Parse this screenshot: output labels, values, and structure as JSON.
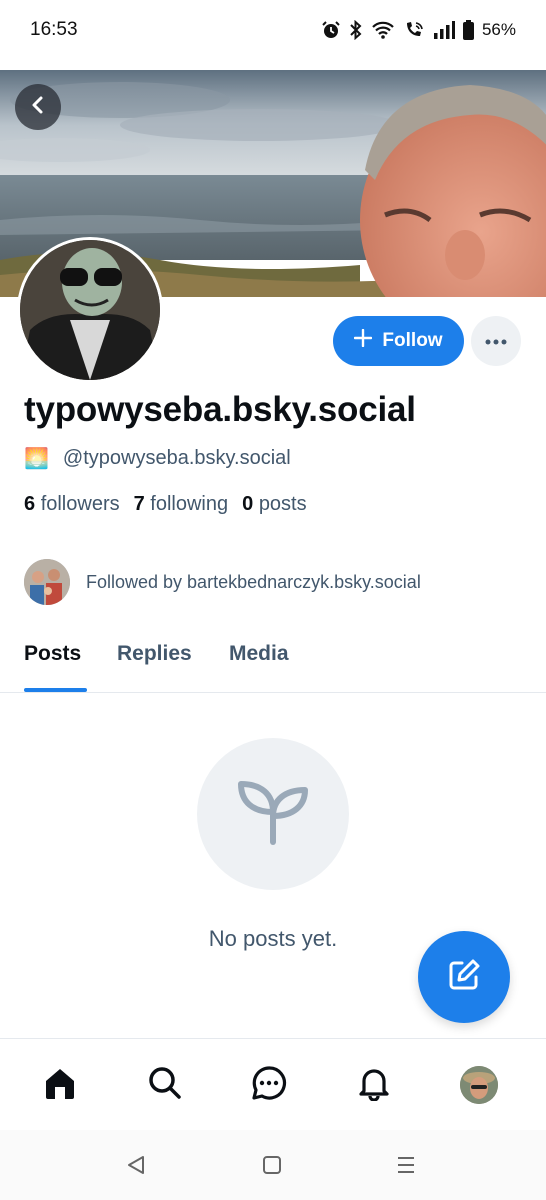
{
  "status_bar": {
    "time": "16:53",
    "battery": "56%",
    "icons": [
      "alarm-icon",
      "bluetooth-icon",
      "wifi-icon",
      "wifi-call-icon",
      "signal-icon",
      "battery-icon"
    ]
  },
  "profile": {
    "display_name": "typowyseba.bsky.social",
    "handle_emoji": "🌅",
    "handle": "@typowyseba.bsky.social",
    "stats": {
      "followers_count": "6",
      "followers_label": "followers",
      "following_count": "7",
      "following_label": "following",
      "posts_count": "0",
      "posts_label": "posts"
    },
    "followed_by": "Followed by bartekbednarczyk.bsky.social"
  },
  "actions": {
    "follow_label": "Follow"
  },
  "tabs": [
    {
      "label": "Posts",
      "active": true
    },
    {
      "label": "Replies",
      "active": false
    },
    {
      "label": "Media",
      "active": false
    }
  ],
  "empty_state": {
    "text": "No posts yet."
  },
  "bottom_nav": [
    "home-icon",
    "search-icon",
    "chat-icon",
    "bell-icon",
    "profile-avatar"
  ],
  "colors": {
    "accent": "#1d7fea",
    "text_primary": "#0b0f14",
    "text_secondary": "#42576c",
    "muted_bg": "#eef1f4"
  }
}
